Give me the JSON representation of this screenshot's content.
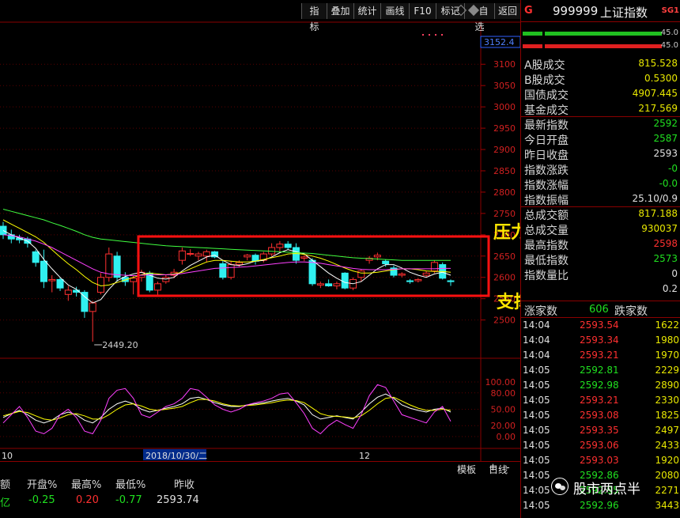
{
  "toolbar": {
    "buttons": [
      "指标",
      "叠加",
      "统计",
      "画线",
      "F10",
      "标记",
      "+自选",
      "返回"
    ]
  },
  "header": {
    "market_tag": "G",
    "code": "999999",
    "name": "上证指数",
    "badge": "SG1"
  },
  "chart_data": [
    {
      "type": "candlestick",
      "title": "",
      "ylim": [
        2449.2,
        3152.4
      ],
      "y_ticks": [
        2500,
        2550,
        2600,
        2650,
        2700,
        2750,
        2800,
        2850,
        2900,
        2950,
        3000,
        3050,
        3100
      ],
      "y_tick_labels": [
        "2500",
        "2550",
        "2600",
        "2650",
        "2700",
        "2750",
        "2800",
        "2850",
        "2900",
        "2950",
        "3000",
        "3050",
        "3100"
      ],
      "top_value_label": "3152.4",
      "low_annotation": "2449.20",
      "low_value": 2449.2,
      "x_labels": [
        "10",
        "2018/10/30/二",
        "12"
      ],
      "candles": [
        {
          "o": 2720,
          "h": 2730,
          "l": 2690,
          "c": 2700
        },
        {
          "o": 2700,
          "h": 2712,
          "l": 2680,
          "c": 2690
        },
        {
          "o": 2692,
          "h": 2700,
          "l": 2680,
          "c": 2688
        },
        {
          "o": 2690,
          "h": 2695,
          "l": 2670,
          "c": 2680
        },
        {
          "o": 2660,
          "h": 2665,
          "l": 2625,
          "c": 2635
        },
        {
          "o": 2638,
          "h": 2665,
          "l": 2575,
          "c": 2590
        },
        {
          "o": 2592,
          "h": 2605,
          "l": 2565,
          "c": 2595
        },
        {
          "o": 2595,
          "h": 2600,
          "l": 2568,
          "c": 2575
        },
        {
          "o": 2560,
          "h": 2580,
          "l": 2545,
          "c": 2570
        },
        {
          "o": 2570,
          "h": 2578,
          "l": 2555,
          "c": 2565
        },
        {
          "o": 2565,
          "h": 2570,
          "l": 2505,
          "c": 2520
        },
        {
          "o": 2520,
          "h": 2545,
          "l": 2449.2,
          "c": 2540
        },
        {
          "o": 2565,
          "h": 2610,
          "l": 2560,
          "c": 2600
        },
        {
          "o": 2600,
          "h": 2670,
          "l": 2590,
          "c": 2655
        },
        {
          "o": 2650,
          "h": 2660,
          "l": 2590,
          "c": 2600
        },
        {
          "o": 2600,
          "h": 2612,
          "l": 2580,
          "c": 2590
        },
        {
          "o": 2590,
          "h": 2605,
          "l": 2560,
          "c": 2598
        },
        {
          "o": 2600,
          "h": 2618,
          "l": 2590,
          "c": 2612
        },
        {
          "o": 2610,
          "h": 2615,
          "l": 2565,
          "c": 2570
        },
        {
          "o": 2570,
          "h": 2590,
          "l": 2555,
          "c": 2585
        },
        {
          "o": 2590,
          "h": 2605,
          "l": 2585,
          "c": 2600
        },
        {
          "o": 2605,
          "h": 2620,
          "l": 2598,
          "c": 2612
        },
        {
          "o": 2640,
          "h": 2670,
          "l": 2630,
          "c": 2662
        },
        {
          "o": 2655,
          "h": 2666,
          "l": 2650,
          "c": 2656
        },
        {
          "o": 2650,
          "h": 2660,
          "l": 2640,
          "c": 2655
        },
        {
          "o": 2650,
          "h": 2665,
          "l": 2635,
          "c": 2660
        },
        {
          "o": 2660,
          "h": 2662,
          "l": 2645,
          "c": 2648
        },
        {
          "o": 2632,
          "h": 2640,
          "l": 2595,
          "c": 2600
        },
        {
          "o": 2600,
          "h": 2638,
          "l": 2595,
          "c": 2630
        },
        {
          "o": 2630,
          "h": 2640,
          "l": 2625,
          "c": 2635
        },
        {
          "o": 2648,
          "h": 2655,
          "l": 2640,
          "c": 2652
        },
        {
          "o": 2652,
          "h": 2656,
          "l": 2630,
          "c": 2638
        },
        {
          "o": 2640,
          "h": 2660,
          "l": 2635,
          "c": 2655
        },
        {
          "o": 2655,
          "h": 2680,
          "l": 2650,
          "c": 2670
        },
        {
          "o": 2670,
          "h": 2685,
          "l": 2660,
          "c": 2678
        },
        {
          "o": 2678,
          "h": 2685,
          "l": 2665,
          "c": 2670
        },
        {
          "o": 2670,
          "h": 2680,
          "l": 2632,
          "c": 2640
        },
        {
          "o": 2645,
          "h": 2652,
          "l": 2638,
          "c": 2648
        },
        {
          "o": 2640,
          "h": 2645,
          "l": 2580,
          "c": 2585
        },
        {
          "o": 2582,
          "h": 2590,
          "l": 2575,
          "c": 2585
        },
        {
          "o": 2585,
          "h": 2595,
          "l": 2578,
          "c": 2580
        },
        {
          "o": 2580,
          "h": 2590,
          "l": 2572,
          "c": 2585
        },
        {
          "o": 2610,
          "h": 2612,
          "l": 2572,
          "c": 2575
        },
        {
          "o": 2575,
          "h": 2600,
          "l": 2570,
          "c": 2595
        },
        {
          "o": 2600,
          "h": 2620,
          "l": 2590,
          "c": 2615
        },
        {
          "o": 2640,
          "h": 2650,
          "l": 2632,
          "c": 2645
        },
        {
          "o": 2648,
          "h": 2658,
          "l": 2640,
          "c": 2652
        },
        {
          "o": 2638,
          "h": 2642,
          "l": 2625,
          "c": 2632
        },
        {
          "o": 2622,
          "h": 2628,
          "l": 2600,
          "c": 2605
        },
        {
          "o": 2605,
          "h": 2612,
          "l": 2600,
          "c": 2608
        },
        {
          "o": 2592,
          "h": 2596,
          "l": 2585,
          "c": 2590
        },
        {
          "o": 2592,
          "h": 2598,
          "l": 2588,
          "c": 2595
        },
        {
          "o": 2605,
          "h": 2615,
          "l": 2600,
          "c": 2610
        },
        {
          "o": 2615,
          "h": 2640,
          "l": 2610,
          "c": 2635
        },
        {
          "o": 2630,
          "h": 2635,
          "l": 2595,
          "c": 2598
        },
        {
          "o": 2592,
          "h": 2595,
          "l": 2580,
          "c": 2590
        }
      ],
      "ma_series": [
        {
          "color": "#ffffff",
          "values": [
            2710,
            2700,
            2692,
            2685,
            2668,
            2642,
            2620,
            2600,
            2582,
            2572,
            2555,
            2540,
            2548,
            2572,
            2592,
            2602,
            2608,
            2612,
            2605,
            2598,
            2596,
            2600,
            2615,
            2628,
            2638,
            2648,
            2652,
            2640,
            2630,
            2628,
            2632,
            2638,
            2640,
            2648,
            2658,
            2665,
            2660,
            2655,
            2640,
            2625,
            2610,
            2598,
            2588,
            2585,
            2590,
            2605,
            2620,
            2630,
            2630,
            2622,
            2612,
            2605,
            2600,
            2608,
            2612,
            2605
          ]
        },
        {
          "color": "#ffff00",
          "values": [
            2735,
            2725,
            2715,
            2705,
            2695,
            2682,
            2665,
            2648,
            2632,
            2618,
            2602,
            2588,
            2580,
            2582,
            2588,
            2594,
            2600,
            2606,
            2610,
            2608,
            2606,
            2608,
            2612,
            2620,
            2628,
            2636,
            2640,
            2640,
            2638,
            2636,
            2636,
            2638,
            2642,
            2646,
            2650,
            2655,
            2656,
            2654,
            2650,
            2645,
            2638,
            2630,
            2622,
            2615,
            2610,
            2610,
            2612,
            2615,
            2618,
            2620,
            2620,
            2618,
            2615,
            2614,
            2614,
            2612
          ]
        },
        {
          "color": "#ff40ff",
          "values": [
            2700,
            2698,
            2695,
            2690,
            2685,
            2678,
            2670,
            2660,
            2650,
            2640,
            2630,
            2620,
            2612,
            2608,
            2606,
            2605,
            2604,
            2605,
            2606,
            2606,
            2606,
            2607,
            2609,
            2612,
            2615,
            2618,
            2621,
            2622,
            2623,
            2624,
            2625,
            2627,
            2629,
            2631,
            2633,
            2635,
            2636,
            2636,
            2635,
            2633,
            2630,
            2627,
            2624,
            2621,
            2619,
            2618,
            2618,
            2618,
            2619,
            2620,
            2620,
            2620,
            2620,
            2620,
            2621,
            2621
          ]
        },
        {
          "color": "#40ff40",
          "values": [
            2760,
            2755,
            2750,
            2745,
            2740,
            2735,
            2728,
            2722,
            2715,
            2708,
            2700,
            2694,
            2690,
            2688,
            2686,
            2684,
            2682,
            2680,
            2678,
            2676,
            2674,
            2673,
            2672,
            2671,
            2670,
            2669,
            2668,
            2667,
            2666,
            2665,
            2664,
            2663,
            2662,
            2661,
            2660,
            2659,
            2658,
            2657,
            2656,
            2654,
            2652,
            2650,
            2648,
            2646,
            2645,
            2644,
            2643,
            2642,
            2641,
            2640,
            2640,
            2640,
            2640,
            2640,
            2640,
            2640
          ]
        }
      ]
    },
    {
      "type": "line",
      "title": "",
      "ylim": [
        0,
        100
      ],
      "y_ticks": [
        0,
        20,
        50,
        80,
        100
      ],
      "y_tick_labels": [
        "0.00",
        "20.00",
        "50.00",
        "80.00",
        "100.00"
      ],
      "series": [
        {
          "color": "#ffffff",
          "values": [
            35,
            42,
            48,
            40,
            30,
            25,
            30,
            40,
            45,
            40,
            30,
            25,
            35,
            50,
            60,
            65,
            60,
            50,
            45,
            48,
            52,
            55,
            60,
            70,
            72,
            68,
            62,
            58,
            55,
            55,
            58,
            60,
            62,
            65,
            68,
            70,
            65,
            58,
            40,
            32,
            35,
            38,
            35,
            32,
            45,
            60,
            72,
            78,
            70,
            58,
            52,
            48,
            45,
            50,
            52,
            45
          ]
        },
        {
          "color": "#ffff00",
          "values": [
            38,
            42,
            46,
            44,
            38,
            32,
            30,
            34,
            40,
            42,
            38,
            32,
            32,
            40,
            50,
            58,
            60,
            56,
            50,
            48,
            50,
            52,
            55,
            62,
            68,
            68,
            65,
            60,
            57,
            56,
            57,
            58,
            60,
            62,
            65,
            67,
            66,
            62,
            52,
            42,
            38,
            37,
            36,
            34,
            38,
            48,
            60,
            70,
            72,
            65,
            58,
            52,
            48,
            48,
            50,
            48
          ]
        },
        {
          "color": "#ff40ff",
          "values": [
            25,
            40,
            55,
            35,
            10,
            5,
            15,
            40,
            50,
            35,
            10,
            5,
            30,
            70,
            85,
            88,
            70,
            40,
            35,
            45,
            55,
            60,
            70,
            88,
            85,
            72,
            58,
            50,
            45,
            50,
            58,
            62,
            65,
            70,
            78,
            80,
            62,
            42,
            15,
            5,
            20,
            30,
            22,
            15,
            40,
            75,
            95,
            90,
            65,
            40,
            35,
            30,
            25,
            45,
            55,
            28
          ]
        }
      ]
    }
  ],
  "annotations": {
    "resistance": "压力位",
    "support": "支撑位"
  },
  "panel": {
    "bars": [
      {
        "value": "45.0",
        "green": true
      },
      {
        "value": "45.0",
        "green": false
      }
    ],
    "info": [
      {
        "label": "A股成交",
        "value": "815.528",
        "color": "#e8e800"
      },
      {
        "label": "B股成交",
        "value": "0.5300",
        "color": "#e8e800"
      },
      {
        "label": "国债成交",
        "value": "4907.445",
        "color": "#e8e800"
      },
      {
        "label": "基金成交",
        "value": "217.569",
        "color": "#e8e800"
      },
      {
        "label": "最新指数",
        "value": "2592",
        "color": "#20e020"
      },
      {
        "label": "今日开盘",
        "value": "2587",
        "color": "#20e020"
      },
      {
        "label": "昨日收盘",
        "value": "2593",
        "color": "#e0e0e0"
      },
      {
        "label": "指数涨跌",
        "value": "-0",
        "color": "#20e020"
      },
      {
        "label": "指数涨幅",
        "value": "-0.0",
        "color": "#20e020"
      },
      {
        "label": "指数振幅",
        "value": "25.10/0.9",
        "color": "#e0e0e0"
      },
      {
        "label": "总成交额",
        "value": "817.188",
        "color": "#e8e800"
      },
      {
        "label": "总成交量",
        "value": "930037",
        "color": "#e8e800"
      },
      {
        "label": "最高指数",
        "value": "2598",
        "color": "#ff3030"
      },
      {
        "label": "最低指数",
        "value": "2573",
        "color": "#20e020"
      },
      {
        "label": "指数量比",
        "value": "0",
        "color": "#e0e0e0"
      },
      {
        "label": "",
        "value": "0.2",
        "color": "#e0e0e0"
      }
    ],
    "tick_header": {
      "up_label": "涨家数",
      "down_count": "606",
      "down_label": "跌家数"
    },
    "ticks": [
      {
        "time": "14:04",
        "price": "2593.54",
        "vol": "1622"
      },
      {
        "time": "14:04",
        "price": "2593.34",
        "vol": "1980"
      },
      {
        "time": "14:04",
        "price": "2593.21",
        "vol": "1970"
      },
      {
        "time": "14:05",
        "price": "2592.81",
        "vol": "2229"
      },
      {
        "time": "14:05",
        "price": "2592.98",
        "vol": "2890"
      },
      {
        "time": "14:05",
        "price": "2593.21",
        "vol": "2330"
      },
      {
        "time": "14:05",
        "price": "2593.08",
        "vol": "1825"
      },
      {
        "time": "14:05",
        "price": "2593.35",
        "vol": "2497"
      },
      {
        "time": "14:05",
        "price": "2593.06",
        "vol": "2433"
      },
      {
        "time": "14:05",
        "price": "2593.03",
        "vol": "1920"
      },
      {
        "time": "14:05",
        "price": "2592.86",
        "vol": "2080"
      },
      {
        "time": "14:05",
        "price": "2592.95",
        "vol": "2271"
      },
      {
        "time": "14:05",
        "price": "2592.96",
        "vol": "3443"
      }
    ],
    "watermark": "股市两点半"
  },
  "bottom": {
    "bar_items": [
      "日线"
    ],
    "bar_buttons": [
      "模板",
      "+",
      "-"
    ],
    "headers": [
      "额",
      "开盘%",
      "最高%",
      "最低%",
      "昨收"
    ],
    "row1": {
      "lead": "亿",
      "open": "-0.25",
      "high": "0.20",
      "low": "-0.77",
      "prev": "2593.74"
    }
  }
}
